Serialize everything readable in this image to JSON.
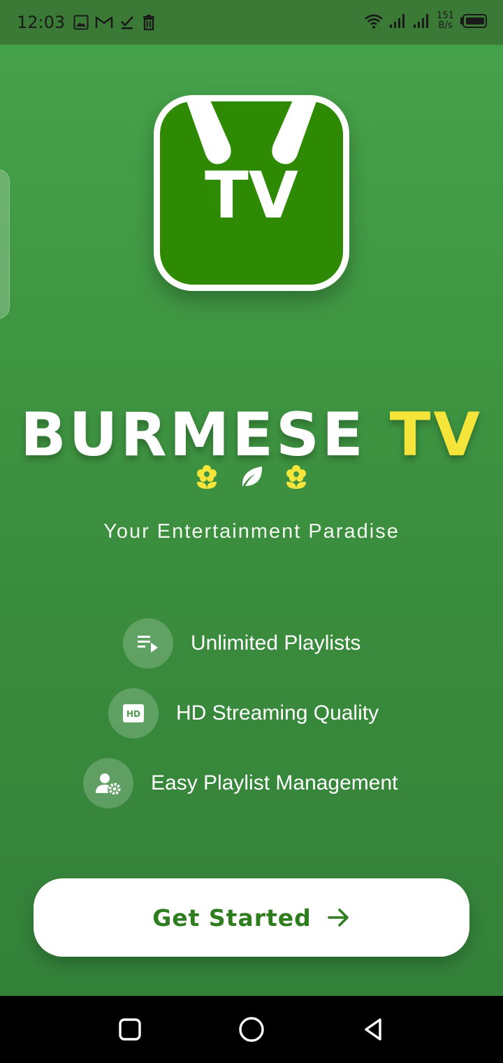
{
  "status_bar": {
    "time": "12:03",
    "left_icons": [
      "image-icon",
      "gmail-icon",
      "download-done-icon",
      "delete-icon"
    ],
    "right_icons": [
      "wifi-icon",
      "signal-icon",
      "signal-icon",
      "battery-icon"
    ],
    "net_speed_value": "151",
    "net_speed_unit": "B/s"
  },
  "logo": {
    "text": "TV",
    "icon": "tv-antenna-logo"
  },
  "app_title": {
    "main": "BURMESE",
    "accent": "TV"
  },
  "decorations": [
    "flower-icon",
    "leaf-icon",
    "flower-icon"
  ],
  "tagline": "Your Entertainment Paradise",
  "features": [
    {
      "icon": "playlist-play-icon",
      "label": "Unlimited Playlists"
    },
    {
      "icon": "hd-icon",
      "label": "HD Streaming Quality"
    },
    {
      "icon": "manage-accounts-icon",
      "label": "Easy Playlist Management"
    }
  ],
  "cta": {
    "label": "Get Started",
    "icon": "arrow-right-icon"
  },
  "nav_bar": {
    "buttons": [
      "recents-button",
      "home-button",
      "back-button"
    ]
  },
  "colors": {
    "brand_green": "#2e8a03",
    "background_top": "#46a24a",
    "background_bottom": "#34813a",
    "accent_yellow": "#f5e53a",
    "cta_text": "#2e7d1f"
  }
}
